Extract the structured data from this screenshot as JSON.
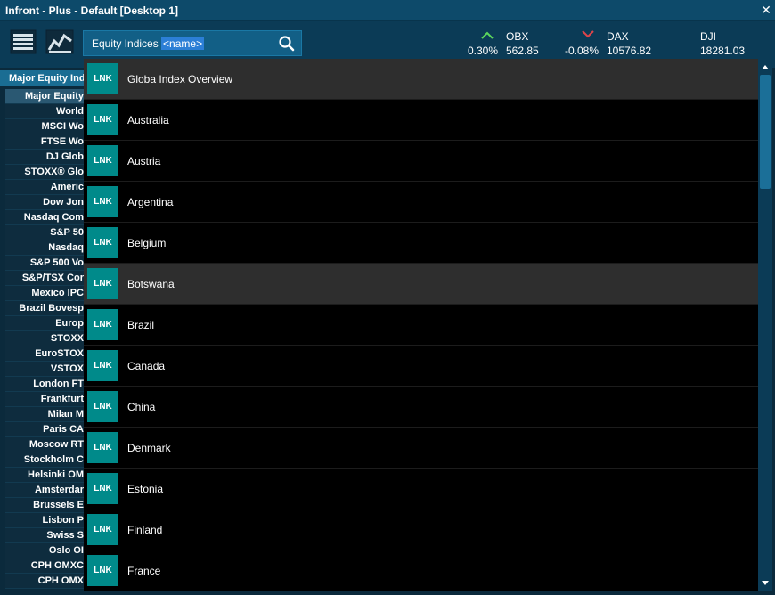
{
  "window": {
    "title": "Infront - Plus - Default [Desktop 1]"
  },
  "search": {
    "prefix": "Equity Indices ",
    "selected_text": "<name>"
  },
  "tickers": [
    {
      "name": "OBX",
      "change": "0.30%",
      "value": "562.85",
      "direction": "up",
      "color": "#5cd65c"
    },
    {
      "name": "DAX",
      "change": "-0.08%",
      "value": "10576.82",
      "direction": "down",
      "color": "#e0454a"
    },
    {
      "name": "DJI",
      "change": "",
      "value": "18281.03",
      "direction": "none",
      "color": ""
    }
  ],
  "left_panel": {
    "header": "Major Equity Ind",
    "rows": [
      "Major Equity",
      "World",
      "MSCI Wo",
      "FTSE Wo",
      "DJ Glob",
      "STOXX® Glo",
      "Americ",
      "Dow Jon",
      "Nasdaq Com",
      "S&P 50",
      "Nasdaq",
      "S&P 500 Vo",
      "S&P/TSX Cor",
      "Mexico IPC",
      "Brazil Bovesp",
      "Europ",
      "STOXX",
      "EuroSTOX",
      "VSTOX",
      "London FT",
      "Frankfurt",
      "Milan M",
      "Paris CA",
      "Moscow RT",
      "Stockholm C",
      "Helsinki OM",
      "Amsterdar",
      "Brussels E",
      "Lisbon P",
      "Swiss S",
      "Oslo OI",
      "CPH OMXC",
      "CPH OMX"
    ]
  },
  "dropdown": {
    "badge": "LNK",
    "items": [
      {
        "label": "Globa Index Overview",
        "highlight": true
      },
      {
        "label": "Australia",
        "highlight": false
      },
      {
        "label": "Austria",
        "highlight": false
      },
      {
        "label": "Argentina",
        "highlight": false
      },
      {
        "label": "Belgium",
        "highlight": false
      },
      {
        "label": "Botswana",
        "highlight": true
      },
      {
        "label": "Brazil",
        "highlight": false
      },
      {
        "label": "Canada",
        "highlight": false
      },
      {
        "label": "China",
        "highlight": false
      },
      {
        "label": "Denmark",
        "highlight": false
      },
      {
        "label": "Estonia",
        "highlight": false
      },
      {
        "label": "Finland",
        "highlight": false
      },
      {
        "label": "France",
        "highlight": false
      }
    ]
  },
  "colors": {
    "accent": "#1b6f98",
    "badge": "#008a8a",
    "highlight_row": "#2e2e2e"
  }
}
